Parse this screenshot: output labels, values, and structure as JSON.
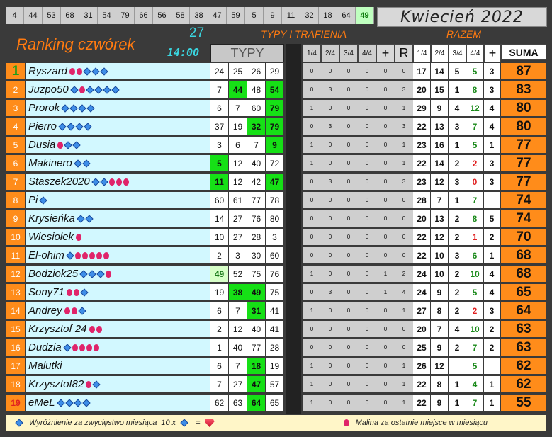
{
  "top_numbers": [
    "4",
    "44",
    "53",
    "68",
    "31",
    "54",
    "79",
    "66",
    "56",
    "58",
    "38",
    "47",
    "59",
    "5",
    "9",
    "11",
    "32",
    "18",
    "64",
    "49"
  ],
  "top_highlight_index": 19,
  "month": "Kwiecień 2022",
  "title": "Ranking czwórek",
  "round_number": "27",
  "time": "14:00",
  "section_typy_trafienia": "TYPY I TRAFIENIA",
  "section_razem": "RAZEM",
  "header": {
    "typy": "TYPY",
    "score_cols": [
      "1/4",
      "2/4",
      "3/4",
      "4/4",
      "+",
      "R"
    ],
    "razem_cols": [
      "1/4",
      "2/4",
      "3/4",
      "4/4",
      "+"
    ],
    "suma": "SUMA"
  },
  "rows": [
    {
      "rank": "1",
      "name": "Ryszard",
      "marks": [
        "r",
        "r",
        "d",
        "d",
        "d"
      ],
      "typy": [
        "24",
        "25",
        "26",
        "29"
      ],
      "hits": [],
      "score": [
        "0",
        "0",
        "0",
        "0",
        "0",
        "0"
      ],
      "razem": [
        "17",
        "14",
        "5",
        "5",
        "3"
      ],
      "suma": "87"
    },
    {
      "rank": "2",
      "name": "Juzpo50",
      "marks": [
        "d",
        "r",
        "d",
        "d",
        "d",
        "d"
      ],
      "typy": [
        "7",
        "44",
        "48",
        "54"
      ],
      "hits": [
        1,
        3
      ],
      "score": [
        "0",
        "3",
        "0",
        "0",
        "0",
        "3"
      ],
      "razem": [
        "20",
        "15",
        "1",
        "8",
        "3"
      ],
      "suma": "83"
    },
    {
      "rank": "3",
      "name": "Prorok",
      "marks": [
        "d",
        "d",
        "d",
        "d"
      ],
      "typy": [
        "6",
        "7",
        "60",
        "79"
      ],
      "hits": [
        3
      ],
      "score": [
        "1",
        "0",
        "0",
        "0",
        "0",
        "1"
      ],
      "razem": [
        "29",
        "9",
        "4",
        "12",
        "4"
      ],
      "suma": "80"
    },
    {
      "rank": "4",
      "name": "Pierro",
      "marks": [
        "d",
        "d",
        "d",
        "d"
      ],
      "typy": [
        "37",
        "19",
        "32",
        "79"
      ],
      "hits": [
        2,
        3
      ],
      "score": [
        "0",
        "3",
        "0",
        "0",
        "0",
        "3"
      ],
      "razem": [
        "22",
        "13",
        "3",
        "7",
        "4"
      ],
      "suma": "80"
    },
    {
      "rank": "5",
      "name": "Dusia",
      "marks": [
        "r",
        "d",
        "d"
      ],
      "typy": [
        "3",
        "6",
        "7",
        "9"
      ],
      "hits": [
        3
      ],
      "score": [
        "1",
        "0",
        "0",
        "0",
        "0",
        "1"
      ],
      "razem": [
        "23",
        "16",
        "1",
        "5",
        "1"
      ],
      "suma": "77"
    },
    {
      "rank": "6",
      "name": "Makinero",
      "marks": [
        "d",
        "d"
      ],
      "typy": [
        "5",
        "12",
        "40",
        "72"
      ],
      "hits": [
        0
      ],
      "score": [
        "1",
        "0",
        "0",
        "0",
        "0",
        "1"
      ],
      "razem": [
        "22",
        "14",
        "2",
        "2",
        "3"
      ],
      "suma": "77"
    },
    {
      "rank": "7",
      "name": "Staszek2020",
      "marks": [
        "d",
        "d",
        "r",
        "r",
        "r"
      ],
      "typy": [
        "11",
        "12",
        "42",
        "47"
      ],
      "hits": [
        0,
        3
      ],
      "score": [
        "0",
        "3",
        "0",
        "0",
        "0",
        "3"
      ],
      "razem": [
        "23",
        "12",
        "3",
        "0",
        "3"
      ],
      "suma": "77"
    },
    {
      "rank": "8",
      "name": "Pi",
      "marks": [
        "d"
      ],
      "typy": [
        "60",
        "61",
        "77",
        "78"
      ],
      "hits": [],
      "score": [
        "0",
        "0",
        "0",
        "0",
        "0",
        "0"
      ],
      "razem": [
        "28",
        "7",
        "1",
        "7",
        ""
      ],
      "suma": "74"
    },
    {
      "rank": "9",
      "name": "Krysieńka",
      "marks": [
        "d",
        "d"
      ],
      "typy": [
        "14",
        "27",
        "76",
        "80"
      ],
      "hits": [],
      "score": [
        "0",
        "0",
        "0",
        "0",
        "0",
        "0"
      ],
      "razem": [
        "20",
        "13",
        "2",
        "8",
        "5"
      ],
      "suma": "74"
    },
    {
      "rank": "10",
      "name": "Wiesiołek",
      "marks": [
        "r"
      ],
      "typy": [
        "10",
        "27",
        "28",
        "3"
      ],
      "hits": [],
      "score": [
        "0",
        "0",
        "0",
        "0",
        "0",
        "0"
      ],
      "razem": [
        "22",
        "12",
        "2",
        "1",
        "2"
      ],
      "suma": "70"
    },
    {
      "rank": "11",
      "name": "El-ohim",
      "marks": [
        "d",
        "r",
        "r",
        "r",
        "r",
        "r"
      ],
      "typy": [
        "2",
        "3",
        "30",
        "60"
      ],
      "hits": [],
      "score": [
        "0",
        "0",
        "0",
        "0",
        "0",
        "0"
      ],
      "razem": [
        "22",
        "10",
        "3",
        "6",
        "1"
      ],
      "suma": "68"
    },
    {
      "rank": "12",
      "name": "Bodziok25",
      "marks": [
        "d",
        "d",
        "d",
        "r"
      ],
      "typy": [
        "49",
        "52",
        "75",
        "76"
      ],
      "hits": [
        0
      ],
      "hits_light": [
        0
      ],
      "score": [
        "1",
        "0",
        "0",
        "0",
        "1",
        "2"
      ],
      "razem": [
        "24",
        "10",
        "2",
        "10",
        "4"
      ],
      "suma": "68"
    },
    {
      "rank": "13",
      "name": "Sony71",
      "marks": [
        "r",
        "r",
        "d"
      ],
      "typy": [
        "19",
        "38",
        "49",
        "75"
      ],
      "hits": [
        1,
        2
      ],
      "score": [
        "0",
        "3",
        "0",
        "0",
        "1",
        "4"
      ],
      "razem": [
        "24",
        "9",
        "2",
        "5",
        "4"
      ],
      "suma": "65"
    },
    {
      "rank": "14",
      "name": "Andrey",
      "marks": [
        "r",
        "r",
        "d"
      ],
      "typy": [
        "6",
        "7",
        "31",
        "41"
      ],
      "hits": [
        2
      ],
      "score": [
        "1",
        "0",
        "0",
        "0",
        "0",
        "1"
      ],
      "razem": [
        "27",
        "8",
        "2",
        "2",
        "3"
      ],
      "suma": "64"
    },
    {
      "rank": "15",
      "name": "Krzysztof 24",
      "marks": [
        "r",
        "r"
      ],
      "typy": [
        "2",
        "12",
        "40",
        "41"
      ],
      "hits": [],
      "score": [
        "0",
        "0",
        "0",
        "0",
        "0",
        "0"
      ],
      "razem": [
        "20",
        "7",
        "4",
        "10",
        "2"
      ],
      "suma": "63"
    },
    {
      "rank": "16",
      "name": "Dudzia",
      "marks": [
        "d",
        "r",
        "r",
        "r",
        "r"
      ],
      "typy": [
        "1",
        "40",
        "77",
        "28"
      ],
      "hits": [],
      "score": [
        "0",
        "0",
        "0",
        "0",
        "0",
        "0"
      ],
      "razem": [
        "25",
        "9",
        "2",
        "7",
        "2"
      ],
      "suma": "63"
    },
    {
      "rank": "17",
      "name": "Malutki",
      "marks": [],
      "typy": [
        "6",
        "7",
        "18",
        "19"
      ],
      "hits": [
        2
      ],
      "score": [
        "1",
        "0",
        "0",
        "0",
        "0",
        "1"
      ],
      "razem": [
        "26",
        "12",
        "",
        "5",
        ""
      ],
      "suma": "62"
    },
    {
      "rank": "18",
      "name": "Krzysztof82",
      "marks": [
        "r",
        "d"
      ],
      "typy": [
        "7",
        "27",
        "47",
        "57"
      ],
      "hits": [
        2
      ],
      "score": [
        "1",
        "0",
        "0",
        "0",
        "0",
        "1"
      ],
      "razem": [
        "22",
        "8",
        "1",
        "4",
        "1"
      ],
      "suma": "62"
    },
    {
      "rank": "19",
      "name": "eMeL",
      "marks": [
        "d",
        "d",
        "d",
        "d"
      ],
      "typy": [
        "62",
        "63",
        "64",
        "65"
      ],
      "hits": [
        2
      ],
      "score": [
        "1",
        "0",
        "0",
        "0",
        "0",
        "1"
      ],
      "razem": [
        "22",
        "9",
        "1",
        "7",
        "1"
      ],
      "suma": "55"
    }
  ],
  "footer": {
    "diamond_text": "Wyróżnienie za zwycięstwo miesiąca",
    "times_text": "10 x",
    "equals_text": "=",
    "rasp_text": "Malina za ostatnie miejsce w miesiącu"
  },
  "colors": {
    "orange": "#ff8c1a",
    "green": "#16e016",
    "cyan": "#d2f8ff",
    "dark": "#222222"
  }
}
